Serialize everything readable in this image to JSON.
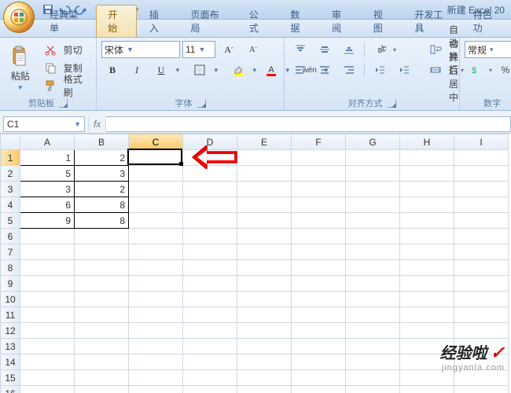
{
  "title": "新建 Excel 20",
  "tabs": [
    "经典菜单",
    "开始",
    "插入",
    "页面布局",
    "公式",
    "数据",
    "审阅",
    "视图",
    "开发工具",
    "特色功"
  ],
  "activeTabIndex": 1,
  "clipboard": {
    "paste": "粘贴",
    "cut": "剪切",
    "copy": "复制",
    "painter": "格式刷",
    "groupTitle": "剪贴板"
  },
  "font": {
    "name": "宋体",
    "size": "11",
    "groupTitle": "字体",
    "bold": "B",
    "italic": "I",
    "underline": "U",
    "wen": "wén"
  },
  "align": {
    "groupTitle": "对齐方式",
    "wrap": "自动换行",
    "merge": "合并后居中"
  },
  "number": {
    "groupTitle": "数字",
    "format": "常规",
    "pct": "%"
  },
  "nameBox": "C1",
  "formula": "",
  "columns": [
    "A",
    "B",
    "C",
    "D",
    "E",
    "F",
    "G",
    "H",
    "I"
  ],
  "rowCount": 17,
  "selected": {
    "col": "C",
    "row": 1
  },
  "cells": {
    "A1": "1",
    "B1": "2",
    "A2": "5",
    "B2": "3",
    "A3": "3",
    "B3": "2",
    "A4": "6",
    "B4": "8",
    "A5": "9",
    "B5": "8"
  },
  "dataRange": {
    "r1": 1,
    "r2": 5,
    "cols": [
      "A",
      "B"
    ]
  },
  "fx_label": "fx",
  "watermark": {
    "l1": "经验啦",
    "l2": "jingyanla.com"
  }
}
